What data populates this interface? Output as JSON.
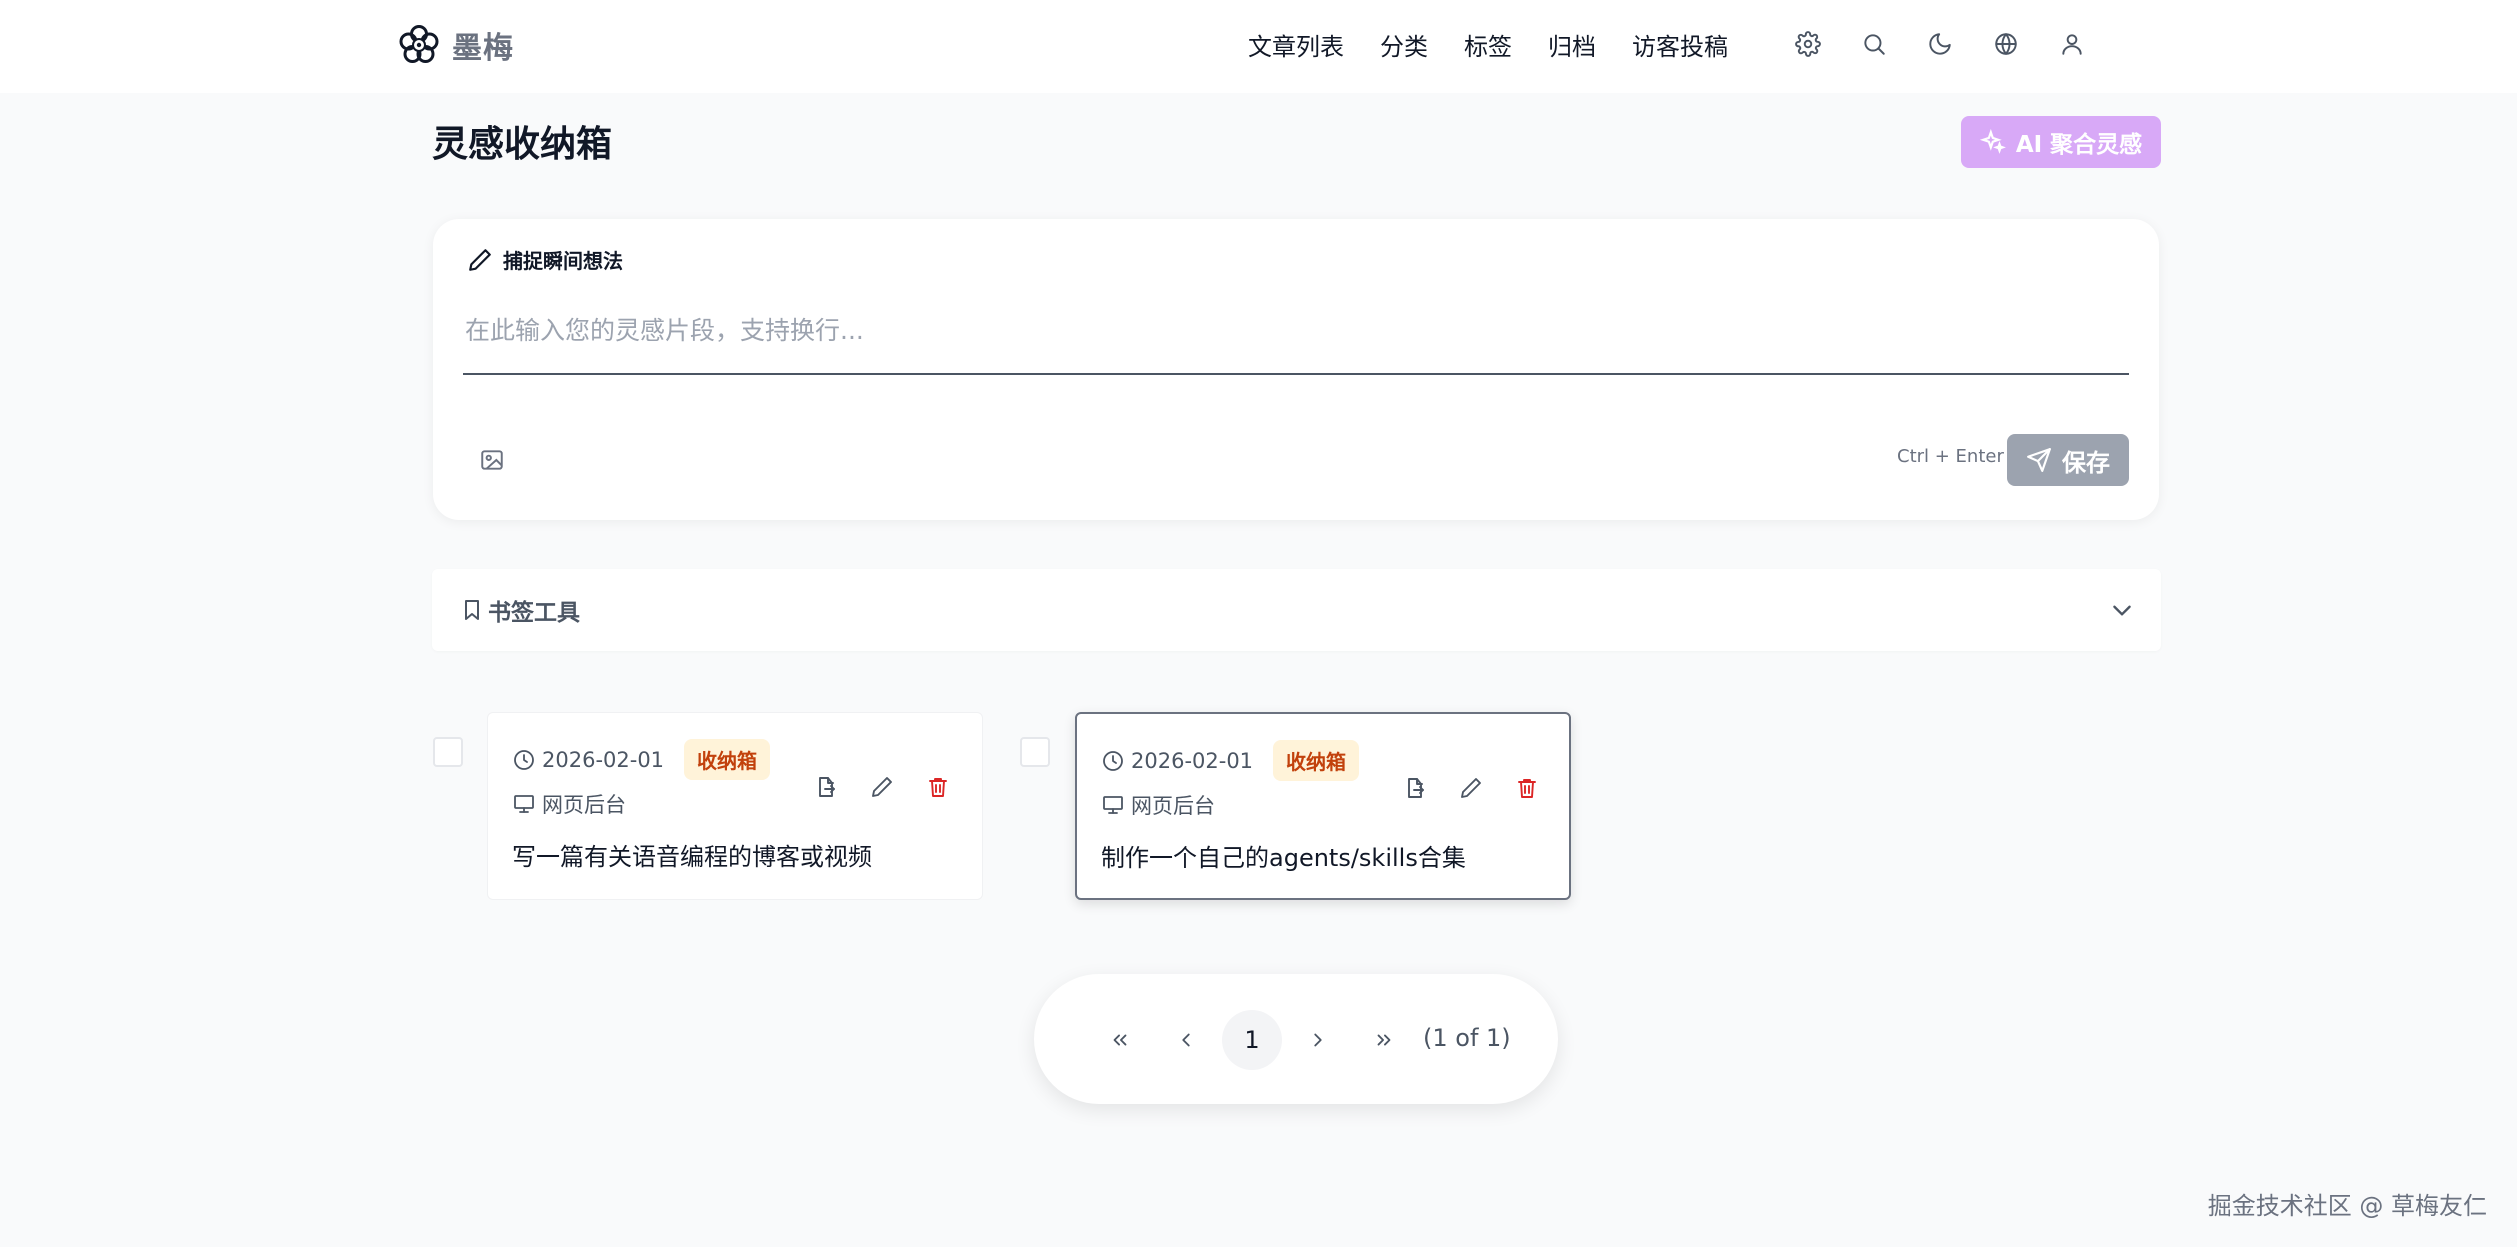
{
  "header": {
    "logo_text": "墨梅",
    "nav": [
      "文章列表",
      "分类",
      "标签",
      "归档",
      "访客投稿"
    ],
    "icons": [
      "gear-icon",
      "search-icon",
      "moon-icon",
      "globe-icon",
      "user-icon"
    ]
  },
  "page": {
    "title": "灵感收纳箱",
    "ai_button": "AI 聚合灵感"
  },
  "capture": {
    "label": "捕捉瞬间想法",
    "placeholder": "在此输入您的灵感片段，支持换行...",
    "shortcut": "Ctrl + Enter",
    "save_label": "保存"
  },
  "bookmark": {
    "label": "书签工具"
  },
  "notes": [
    {
      "date": "2026-02-01",
      "badge": "收纳箱",
      "source": "网页后台",
      "content": "写一篇有关语音编程的博客或视频"
    },
    {
      "date": "2026-02-01",
      "badge": "收纳箱",
      "source": "网页后台",
      "content": "制作一个自己的agents/skills合集"
    }
  ],
  "pagination": {
    "first": "«",
    "prev": "‹",
    "current": "1",
    "next": "›",
    "last": "»",
    "info": "(1 of 1)"
  },
  "watermark": "掘金技术社区 @ 草梅友仁",
  "colors": {
    "accent_purple": "#d8a9f7",
    "badge_bg": "#fff3d9",
    "badge_text": "#c2410c",
    "delete_red": "#dc2626",
    "save_disabled": "#9ca3af"
  }
}
